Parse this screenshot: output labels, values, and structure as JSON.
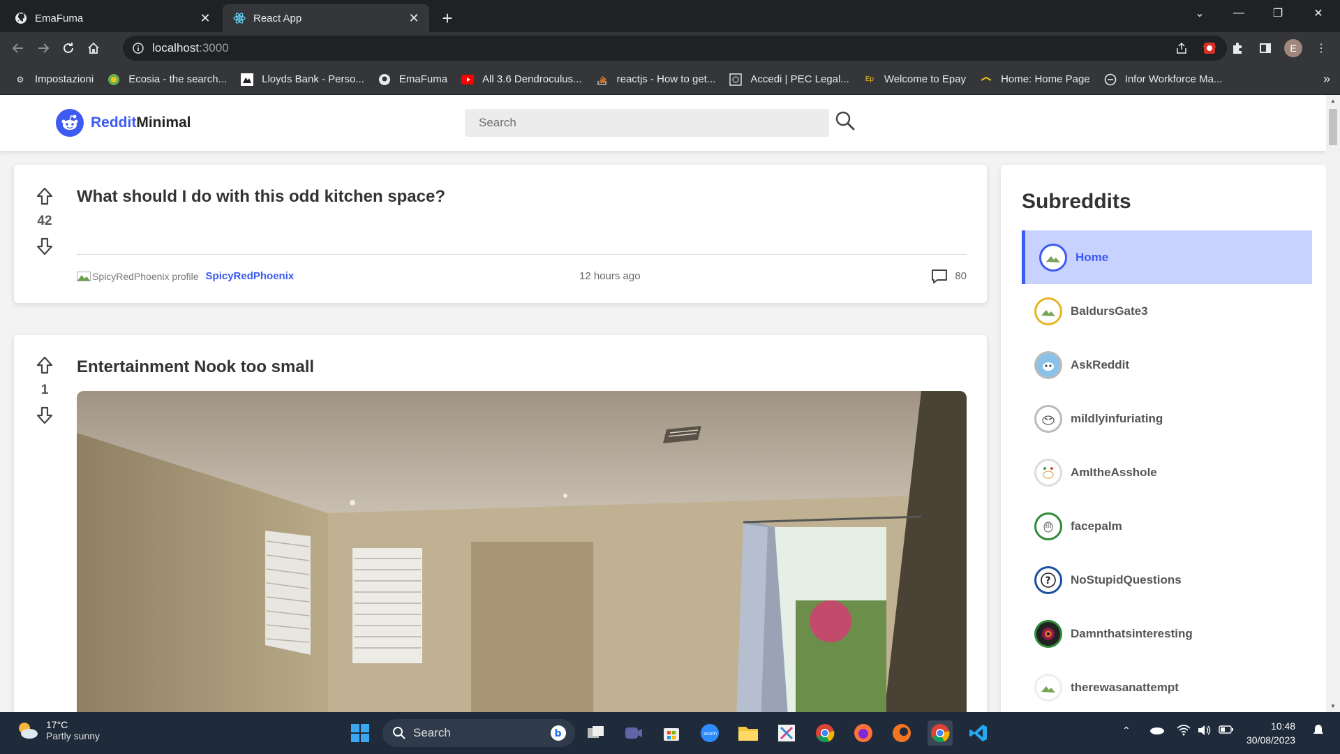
{
  "browser": {
    "tabs": [
      {
        "label": "EmaFuma",
        "icon": "github-icon"
      },
      {
        "label": "React App",
        "icon": "react-icon"
      }
    ],
    "url_host": "localhost",
    "url_port": ":3000",
    "profile_initial": "E",
    "bookmarks": [
      {
        "label": "Impostazioni",
        "icon": "gear-icon"
      },
      {
        "label": "Ecosia - the search...",
        "icon": "ecosia-icon"
      },
      {
        "label": "Lloyds Bank - Perso...",
        "icon": "lloyds-icon"
      },
      {
        "label": "EmaFuma",
        "icon": "github-icon"
      },
      {
        "label": "All 3.6 Dendroculus...",
        "icon": "youtube-icon"
      },
      {
        "label": "reactjs - How to get...",
        "icon": "stackoverflow-icon"
      },
      {
        "label": "Accedi | PEC Legal...",
        "icon": "pec-icon"
      },
      {
        "label": "Welcome to Epay",
        "icon": "epay-icon"
      },
      {
        "label": "Home: Home Page",
        "icon": "home-page-icon"
      },
      {
        "label": "Infor Workforce Ma...",
        "icon": "infor-icon"
      }
    ]
  },
  "app": {
    "logo_accent": "Reddit",
    "logo_rest": "Minimal",
    "search_placeholder": "Search",
    "accent_color": "#3d5af1"
  },
  "posts": [
    {
      "score": "42",
      "title": "What should I do with this odd kitchen space?",
      "author_img_alt": "SpicyRedPhoenix profile",
      "author": "SpicyRedPhoenix",
      "time": "12 hours ago",
      "comments": "80"
    },
    {
      "score": "1",
      "title": "Entertainment Nook too small",
      "image": "room-with-windows-and-curtain"
    }
  ],
  "sidebar": {
    "title": "Subreddits",
    "items": [
      {
        "label": "Home",
        "active": true,
        "ring": "#3d5af1"
      },
      {
        "label": "BaldursGate3",
        "ring": "#e6b422"
      },
      {
        "label": "AskReddit",
        "ring": "#cfcfcf"
      },
      {
        "label": "mildlyinfuriating",
        "ring": "#cfcfcf"
      },
      {
        "label": "AmItheAsshole",
        "ring": "#cfcfcf"
      },
      {
        "label": "facepalm",
        "ring": "#2e8b3d"
      },
      {
        "label": "NoStupidQuestions",
        "ring": "#1a4f9c"
      },
      {
        "label": "Damnthatsinteresting",
        "ring": "#2e8b3d"
      },
      {
        "label": "therewasanattempt",
        "ring": "#cfcfcf"
      }
    ]
  },
  "taskbar": {
    "temp": "17°C",
    "condition": "Partly sunny",
    "search_label": "Search",
    "time": "10:48",
    "date": "30/08/2023"
  }
}
